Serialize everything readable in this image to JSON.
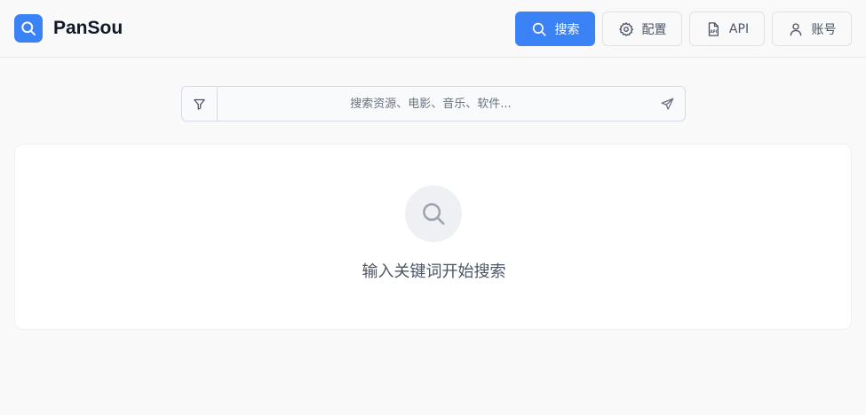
{
  "header": {
    "brand": "PanSou",
    "nav": {
      "search": "搜索",
      "config": "配置",
      "api": "API",
      "account": "账号"
    }
  },
  "search": {
    "placeholder": "搜索资源、电影、音乐、软件...",
    "value": ""
  },
  "empty_state": {
    "message": "输入关键词开始搜索"
  },
  "colors": {
    "accent": "#3b82f6",
    "background": "#f9f9f9",
    "panel": "#ffffff"
  },
  "icons": [
    "search-icon",
    "gear-icon",
    "api-file-icon",
    "user-icon",
    "filter-icon",
    "send-icon"
  ]
}
